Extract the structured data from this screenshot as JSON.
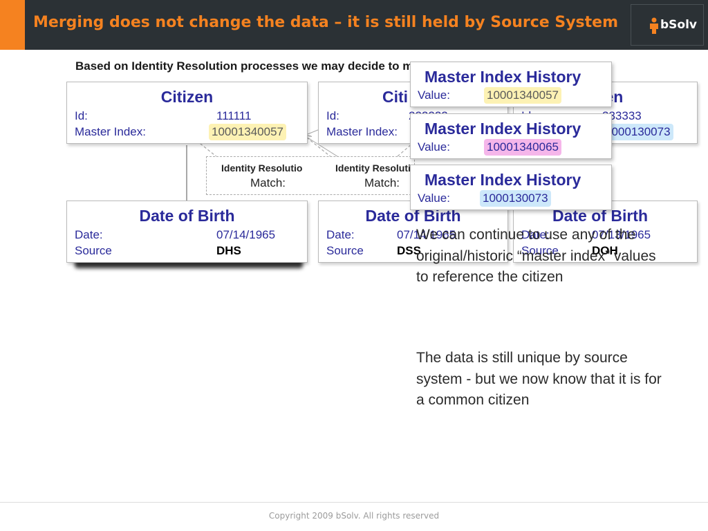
{
  "header": {
    "title": "Merging does not change the data – it is still held by Source System",
    "logo_text": "bSolv",
    "accent_color": "#f58220",
    "background_color": "#2b3135"
  },
  "subtitle": "Based on Identity Resolution processes we may decide to merge other records…",
  "citizens": [
    {
      "title": "Citizen",
      "id_label": "Id:",
      "id_value": "111111",
      "mi_label": "Master Index:",
      "mi_value": "10001340057",
      "mi_highlight": "yellow"
    },
    {
      "title": "Citi",
      "id_label": "Id:",
      "id_value": "222222",
      "mi_label": "Master Index:",
      "mi_value": "",
      "mi_highlight": "pink"
    },
    {
      "title": "zen",
      "id_label": "Id:",
      "id_value": "333333",
      "mi_label": "",
      "mi_value": "1000130073",
      "mi_highlight": "blue"
    }
  ],
  "identity_resolution": [
    {
      "title": "Identity Resolutio",
      "match_label": "Match:"
    },
    {
      "title": "Identity Resolution P",
      "match_label": "Match:"
    }
  ],
  "dobs": [
    {
      "title": "Date of Birth",
      "date_label": "Date:",
      "date_value": "07/14/1965",
      "source_label": "Source",
      "source_value": "DHS"
    },
    {
      "title": "Date of Birth",
      "date_label": "Date:",
      "date_value": "07/14/1965",
      "source_label": "Source",
      "source_value": "DSS"
    },
    {
      "title": "Date of Birth",
      "date_label": "Date:",
      "date_value": "07/13/1965",
      "source_label": "Source",
      "source_value": "DOH"
    }
  ],
  "history": [
    {
      "title": "Master Index History",
      "value_label": "Value:",
      "value": "10001340057",
      "highlight": "yellow"
    },
    {
      "title": "Master Index History",
      "value_label": "Value:",
      "value": "10001340065",
      "highlight": "pink"
    },
    {
      "title": "Master Index History",
      "value_label": "Value:",
      "value": "1000130073",
      "highlight": "blue"
    }
  ],
  "paragraphs": [
    "We can continue to use any of the original/historic “master index” values to reference the citizen",
    "The data is still unique by source system -  but we now know that it is for a common citizen"
  ],
  "footer": "Copyright 2009 bSolv. All rights reserved"
}
